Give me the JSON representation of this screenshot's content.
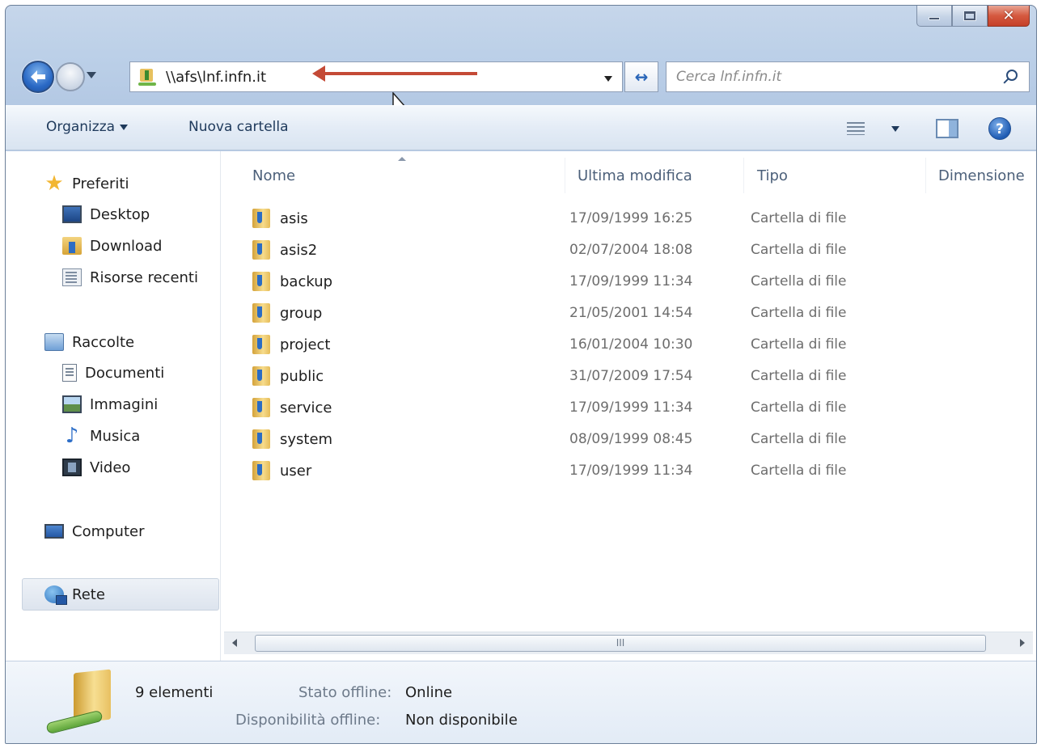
{
  "window": {
    "caption_close": "✕"
  },
  "address_bar": {
    "path": "\\\\afs\\lnf.infn.it",
    "refresh_glyph": "↔"
  },
  "search": {
    "placeholder": "Cerca lnf.infn.it"
  },
  "command_bar": {
    "organize_label": "Organizza",
    "new_folder_label": "Nuova cartella",
    "help_glyph": "?"
  },
  "nav_pane": {
    "favorites": "Preferiti",
    "desktop": "Desktop",
    "download": "Download",
    "recent": "Risorse recenti",
    "libraries": "Raccolte",
    "documents": "Documenti",
    "pictures": "Immagini",
    "music": "Musica",
    "video": "Video",
    "computer": "Computer",
    "network": "Rete"
  },
  "columns": {
    "name": "Nome",
    "modified": "Ultima modifica",
    "type": "Tipo",
    "size": "Dimensione"
  },
  "files": [
    {
      "name": "asis",
      "modified": "17/09/1999 16:25",
      "type": "Cartella di file"
    },
    {
      "name": "asis2",
      "modified": "02/07/2004 18:08",
      "type": "Cartella di file"
    },
    {
      "name": "backup",
      "modified": "17/09/1999 11:34",
      "type": "Cartella di file"
    },
    {
      "name": "group",
      "modified": "21/05/2001 14:54",
      "type": "Cartella di file"
    },
    {
      "name": "project",
      "modified": "16/01/2004 10:30",
      "type": "Cartella di file"
    },
    {
      "name": "public",
      "modified": "31/07/2009 17:54",
      "type": "Cartella di file"
    },
    {
      "name": "service",
      "modified": "17/09/1999 11:34",
      "type": "Cartella di file"
    },
    {
      "name": "system",
      "modified": "08/09/1999 08:45",
      "type": "Cartella di file"
    },
    {
      "name": "user",
      "modified": "17/09/1999 11:34",
      "type": "Cartella di file"
    }
  ],
  "scrollbar": {
    "thumb_grip": "III"
  },
  "details": {
    "count": "9 elementi",
    "offline_status_label": "Stato offline:",
    "offline_status_value": "Online",
    "offline_availability_label": "Disponibilità offline:",
    "offline_availability_value": "Non disponibile"
  },
  "colors": {
    "accent": "#2a66b8",
    "annotation_arrow": "#c44a36",
    "close_button": "#d5593f"
  }
}
